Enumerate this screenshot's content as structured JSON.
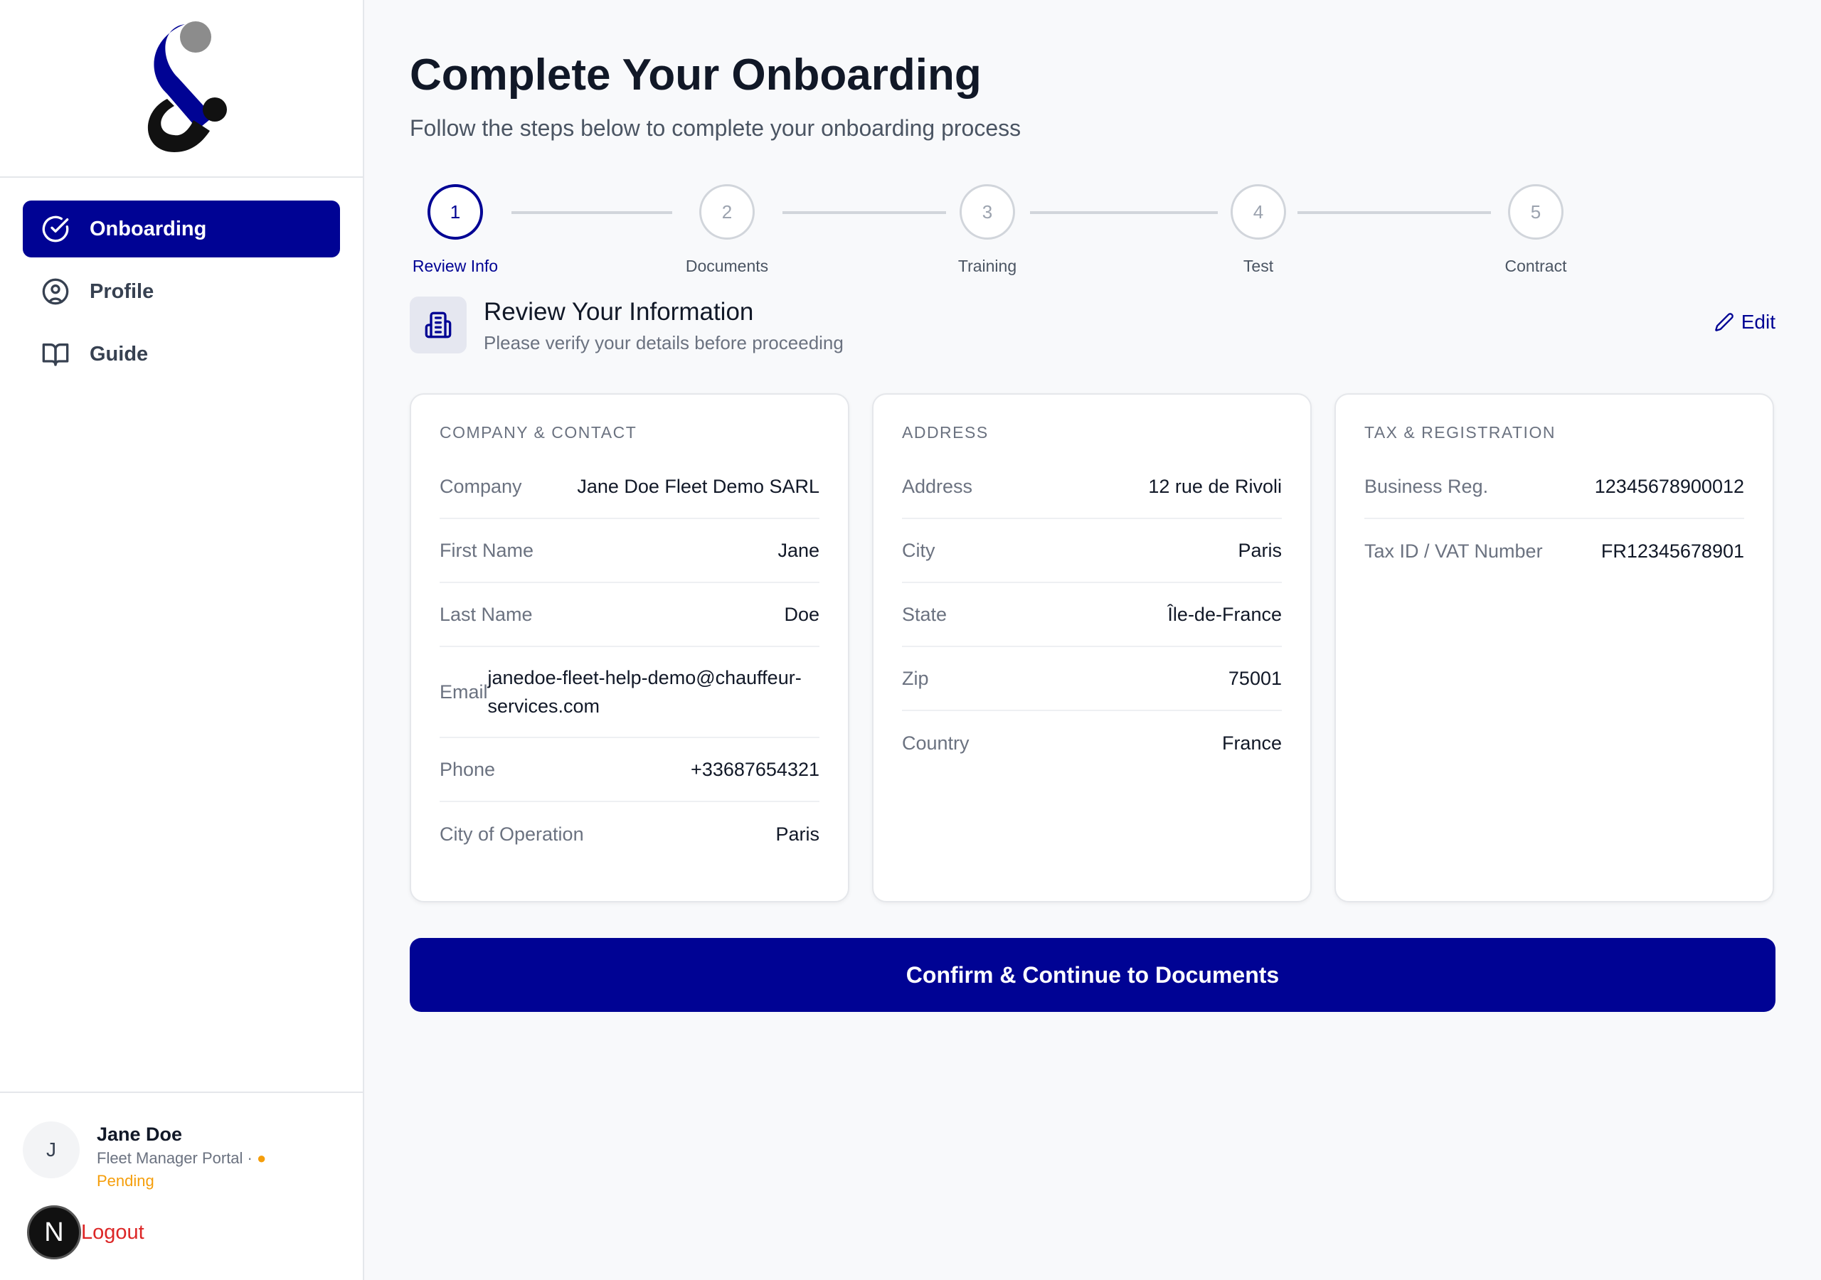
{
  "brand": {
    "primary": "#000394",
    "accent_gray": "#8c8c8c"
  },
  "sidebar": {
    "items": [
      {
        "label": "Onboarding",
        "icon": "check-circle-icon",
        "active": true
      },
      {
        "label": "Profile",
        "icon": "user-circle-icon",
        "active": false
      },
      {
        "label": "Guide",
        "icon": "book-open-icon",
        "active": false
      }
    ],
    "user": {
      "initial": "J",
      "name": "Jane Doe",
      "portal": "Fleet Manager Portal ·",
      "status": "Pending",
      "badge": "N",
      "logout_label": "Logout"
    }
  },
  "header": {
    "title": "Complete Your Onboarding",
    "subtitle": "Follow the steps below to complete your onboarding process"
  },
  "steps": [
    {
      "number": "1",
      "label": "Review Info",
      "active": true
    },
    {
      "number": "2",
      "label": "Documents",
      "active": false
    },
    {
      "number": "3",
      "label": "Training",
      "active": false
    },
    {
      "number": "4",
      "label": "Test",
      "active": false
    },
    {
      "number": "5",
      "label": "Contract",
      "active": false
    }
  ],
  "review": {
    "title": "Review Your Information",
    "subtitle": "Please verify your details before proceeding",
    "edit_label": "Edit"
  },
  "cards": {
    "company": {
      "title": "COMPANY & CONTACT",
      "rows": [
        {
          "label": "Company",
          "value": "Jane Doe Fleet Demo SARL"
        },
        {
          "label": "First Name",
          "value": "Jane"
        },
        {
          "label": "Last Name",
          "value": "Doe"
        },
        {
          "label": "Email",
          "value": "janedoe-fleet-help-demo@chauffeur-services.com"
        },
        {
          "label": "Phone",
          "value": "+33687654321"
        },
        {
          "label": "City of Operation",
          "value": "Paris"
        }
      ]
    },
    "address": {
      "title": "ADDRESS",
      "rows": [
        {
          "label": "Address",
          "value": "12 rue de Rivoli"
        },
        {
          "label": "City",
          "value": "Paris"
        },
        {
          "label": "State",
          "value": "Île-de-France"
        },
        {
          "label": "Zip",
          "value": "75001"
        },
        {
          "label": "Country",
          "value": "France"
        }
      ]
    },
    "tax": {
      "title": "TAX & REGISTRATION",
      "rows": [
        {
          "label": "Business Reg.",
          "value": "12345678900012"
        },
        {
          "label": "Tax ID / VAT Number",
          "value": "FR12345678901"
        }
      ]
    }
  },
  "confirm_label": "Confirm & Continue to Documents"
}
